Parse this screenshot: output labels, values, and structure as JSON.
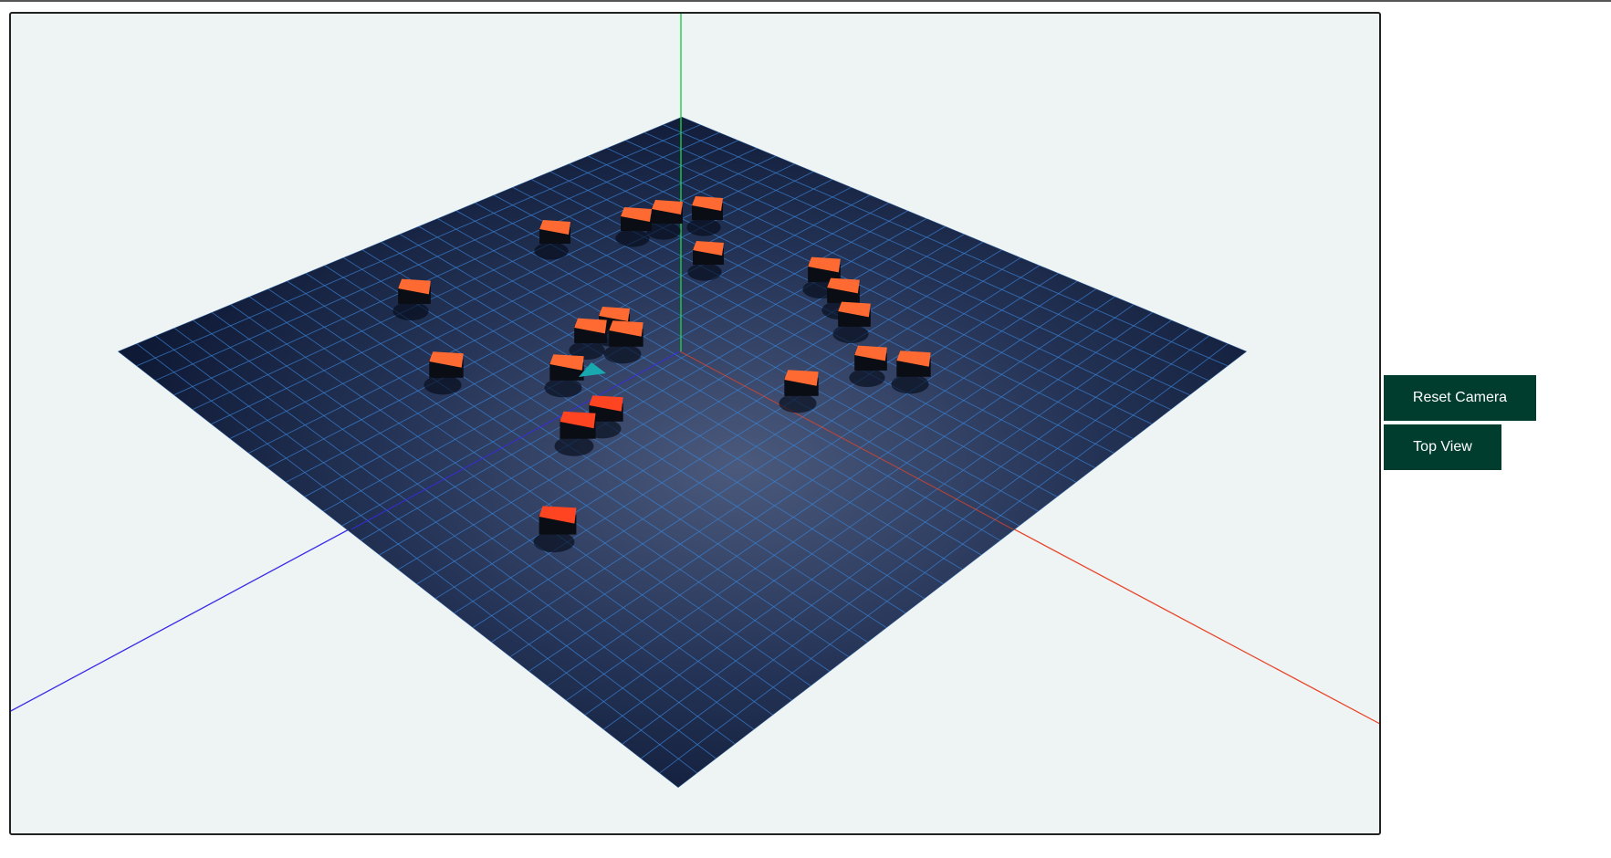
{
  "scene": {
    "plane_color": "#1c2a4a",
    "grid_color": "#3a7fd0",
    "block_color": "#ff6a33",
    "marker_color": "#19a8b0",
    "axis_colors": {
      "x": "#e8452a",
      "y": "#22cc44",
      "z": "#3a2ae8"
    },
    "background": "#eef4f4"
  },
  "controls": {
    "reset_camera_label": "Reset Camera",
    "top_view_label": "Top View",
    "button_color": "#003d2e"
  }
}
